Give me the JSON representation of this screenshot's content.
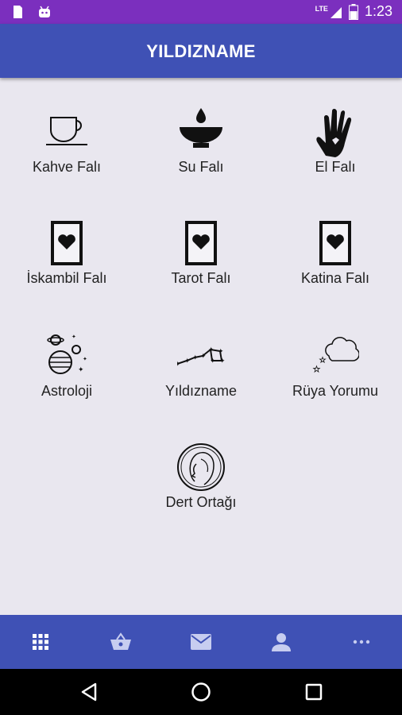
{
  "status_bar": {
    "time": "1:23",
    "network": "LTE",
    "battery_level": 0.6,
    "left_icons": [
      "sd-card-icon",
      "android-icon"
    ]
  },
  "app": {
    "title": "YILDIZNAME",
    "accent": "#3f51b5",
    "status_color": "#7b2fbe"
  },
  "menu": {
    "items": [
      {
        "label": "Kahve Falı",
        "icon": "coffee-cup-icon"
      },
      {
        "label": "Su Falı",
        "icon": "water-bowl-icon"
      },
      {
        "label": "El Falı",
        "icon": "hand-icon"
      },
      {
        "label": "İskambil Falı",
        "icon": "heart-card-icon"
      },
      {
        "label": "Tarot Falı",
        "icon": "heart-card-icon"
      },
      {
        "label": "Katina Falı",
        "icon": "heart-card-icon"
      },
      {
        "label": "Astroloji",
        "icon": "planets-icon"
      },
      {
        "label": "Yıldızname",
        "icon": "constellation-icon"
      },
      {
        "label": "Rüya Yorumu",
        "icon": "dream-cloud-icon"
      },
      {
        "label": "Dert Ortağı",
        "icon": "woman-face-icon"
      }
    ]
  },
  "bottom_nav": {
    "items": [
      "grid-icon",
      "basket-icon",
      "mail-icon",
      "person-icon",
      "more-icon"
    ],
    "active_index": 0
  },
  "system_nav": [
    "back-icon",
    "home-icon",
    "recents-icon"
  ]
}
